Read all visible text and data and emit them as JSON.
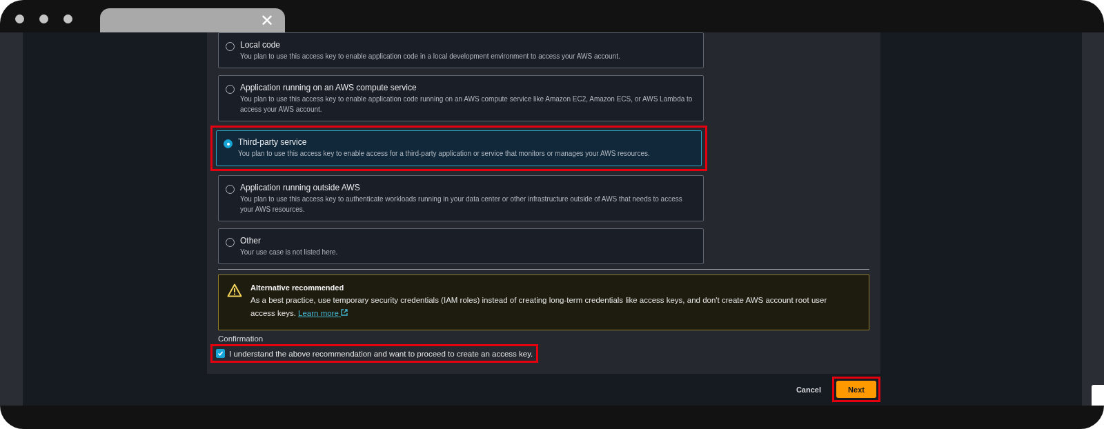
{
  "browser": {
    "tab": {
      "close_label": "✕"
    }
  },
  "use_cases": [
    {
      "title": "Local code",
      "description": "You plan to use this access key to enable application code in a local development environment to access your AWS account.",
      "selected": false,
      "highlighted": false
    },
    {
      "title": "Application running on an AWS compute service",
      "description": "You plan to use this access key to enable application code running on an AWS compute service like Amazon EC2, Amazon ECS, or AWS Lambda to access your AWS account.",
      "selected": false,
      "highlighted": false
    },
    {
      "title": "Third-party service",
      "description": "You plan to use this access key to enable access for a third-party application or service that monitors or manages your AWS resources.",
      "selected": true,
      "highlighted": true
    },
    {
      "title": "Application running outside AWS",
      "description": "You plan to use this access key to authenticate workloads running in your data center or other infrastructure outside of AWS that needs to access your AWS resources.",
      "selected": false,
      "highlighted": false
    },
    {
      "title": "Other",
      "description": "Your use case is not listed here.",
      "selected": false,
      "highlighted": false
    }
  ],
  "alert": {
    "title": "Alternative recommended",
    "text": "As a best practice, use temporary security credentials (IAM roles) instead of creating long-term credentials like access keys, and don't create AWS account root user access keys.",
    "link": "Learn more"
  },
  "confirmation": {
    "label": "Confirmation",
    "text": "I understand the above recommendation and want to proceed to create an access key.",
    "checked": true,
    "highlighted": true
  },
  "actions": {
    "cancel": "Cancel",
    "next": {
      "label": "Next",
      "highlighted": true
    }
  }
}
